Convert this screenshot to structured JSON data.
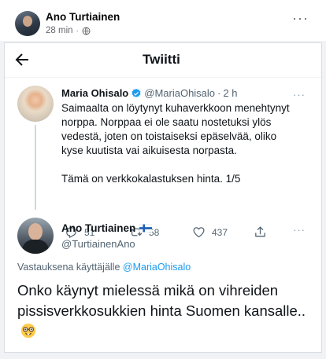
{
  "post": {
    "author": "Ano Turtiainen",
    "time": "28 min",
    "separator": "·",
    "more": "···"
  },
  "twitter": {
    "header_title": "Twiitti",
    "tweet1": {
      "name": "Maria Ohisalo",
      "handle": "@MariaOhisalo",
      "separator": "·",
      "time": "2 h",
      "more": "···",
      "paragraph1": "Saimaalta on löytynyt kuhaverkkoon menehtynyt norppa. Norppaa ei ole saatu nostetuksi ylös vedestä, joten on toistaiseksi epäselvää, oliko kyse kuutista vai aikuisesta norpasta.",
      "paragraph2": "Tämä on verkkokalastuksen hinta. 1/5",
      "replies": "51",
      "retweets": "58",
      "likes": "437"
    },
    "tweet2": {
      "name": "Ano Turtiainen",
      "handle": "@TurtiainenAno",
      "more": "···",
      "replying_prefix": "Vastauksena käyttäjälle",
      "replying_to": "@MariaOhisalo",
      "text": "Onko käynyt mielessä mikä on vihreiden pissisverkkosukkien hinta Suomen kansalle..",
      "emoji": "nerd-face-emoji"
    }
  },
  "colors": {
    "twitter_blue": "#1d9bf0",
    "text_secondary": "#536471",
    "fb_meta": "#65676b"
  }
}
